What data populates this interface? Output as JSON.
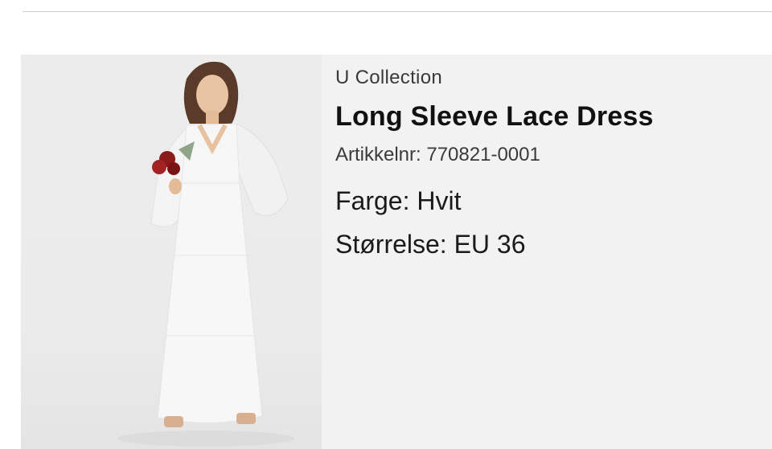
{
  "product": {
    "brand": "U Collection",
    "title": "Long Sleeve Lace Dress",
    "article_label": "Artikkelnr:",
    "article_number": "770821-0001",
    "color_label": "Farge:",
    "color_value": "Hvit",
    "size_label": "Størrelse:",
    "size_value": "EU 36"
  },
  "colors": {
    "card_background": "#f2f2f2",
    "divider": "#cfcfcf",
    "dress": "#f7f7f7",
    "bouquet": "#8b1a1a"
  }
}
